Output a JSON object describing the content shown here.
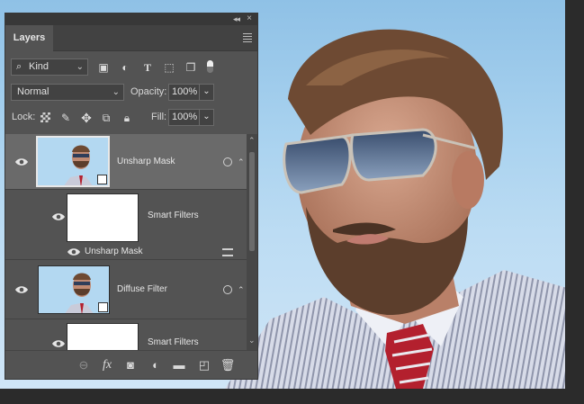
{
  "panel": {
    "tab_label": "Layers",
    "filter": {
      "kind_label": "Kind"
    },
    "blend_mode": "Normal",
    "opacity_label": "Opacity:",
    "opacity_value": "100%",
    "lock_label": "Lock:",
    "fill_label": "Fill:",
    "fill_value": "100%"
  },
  "layers": [
    {
      "name": "Unsharp Mask",
      "smart_filters_label": "Smart Filters",
      "filter_name": "Unsharp Mask"
    },
    {
      "name": "Diffuse Filter",
      "smart_filters_label": "Smart Filters"
    }
  ],
  "icons": {
    "filter_icons": [
      "image-filter-icon",
      "adjustment-filter-icon",
      "type-filter-icon",
      "shape-filter-icon",
      "smart-object-filter-icon",
      "filter-toggle-icon"
    ],
    "lock_icons": [
      "lock-transparent-icon",
      "lock-image-icon",
      "lock-position-icon",
      "lock-artboard-icon",
      "lock-all-icon"
    ],
    "bottom_icons": [
      "link-layers-icon",
      "fx-icon",
      "add-mask-icon",
      "adjustment-layer-icon",
      "new-group-icon",
      "new-layer-icon",
      "delete-layer-icon"
    ]
  },
  "colors": {
    "panel_bg": "#535353",
    "selected_layer_bg": "#6a6a6a",
    "sky": "#a9d2ef"
  }
}
